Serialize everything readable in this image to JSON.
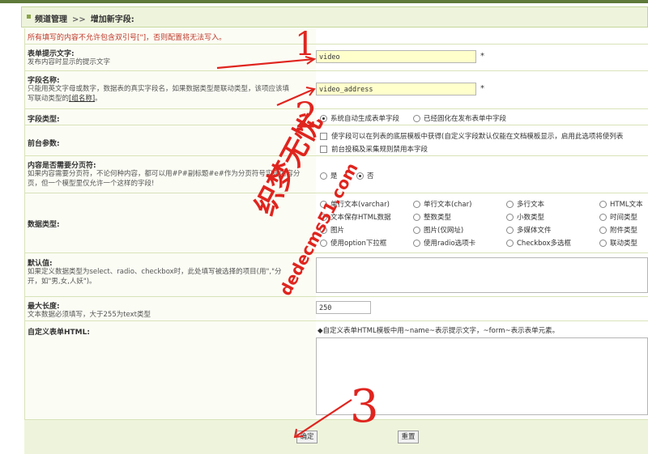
{
  "breadcrumb": {
    "parent": "频道管理",
    "separator": ">>",
    "current": "增加新字段:"
  },
  "warning": "所有填写的内容不允许包含双引号[\"]，否则配置将无法写入。",
  "fields": {
    "prompt_text": {
      "title": "表单提示文字:",
      "desc": "发布内容时显示的提示文字",
      "value": "video",
      "required": "*"
    },
    "field_name": {
      "title": "字段名称:",
      "desc": "只能用英文字母或数字，数据表的真实字段名，如果数据类型是联动类型，该项应该填",
      "desc2": "写联动类型的",
      "desc_link": "[组名称]",
      "desc3": "。",
      "value": "video_address",
      "required": "*"
    },
    "field_type": {
      "title": "字段类型:",
      "opt1": "系统自动生成表单字段",
      "opt2": "已经固化在发布表单中字段"
    },
    "frontend": {
      "title": "前台参数:",
      "opt1": "使字段可以在列表的底层模板中获得(自定义字段默认仅能在文档模板显示，启用此选项将使列表",
      "opt2": "前台投稿及采集规则禁用本字段"
    },
    "paging": {
      "title": "内容是否需要分页符:",
      "desc": "如果内容需要分页符，不论何种内容，都可以用#P#副标题#e#作为分页符号实现内容分",
      "desc2": "页，但一个模型里仅允许一个这样的字段!",
      "yes": "是",
      "no": "否"
    },
    "data_type": {
      "title": "数据类型:",
      "options": [
        [
          "单行文本(varchar)",
          "单行文本(char)",
          "多行文本",
          "HTML文本"
        ],
        [
          "文本保存HTML数据",
          "整数类型",
          "小数类型",
          "时间类型"
        ],
        [
          "图片",
          "图片(仅网址)",
          "多媒体文件",
          "附件类型"
        ],
        [
          "使用option下拉框",
          "使用radio选项卡",
          "Checkbox多选框",
          "联动类型"
        ]
      ]
    },
    "default_value": {
      "title": "默认值:",
      "desc": "如果定义数据类型为select、radio、checkbox时，此处填写被选择的项目(用\",\"分",
      "desc2": "开，如\"男,女,人妖\")。"
    },
    "max_length": {
      "title": "最大长度:",
      "desc": "文本数据必须填写，大于255为text类型",
      "value": "250"
    },
    "custom_html": {
      "title": "自定义表单HTML:",
      "hint": "◆自定义表单HTML模板中用~name~表示提示文字，~form~表示表单元素。"
    }
  },
  "buttons": {
    "ok": "确定",
    "reset": "重置"
  },
  "annotations": {
    "n1": "1",
    "n2": "2",
    "n3": "3"
  },
  "watermark": {
    "brand": "织梦无忧",
    "url": "dedecms51.com"
  },
  "colors": {
    "accent": "#5f7a3a",
    "input_bg": "#ffffcc",
    "warning": "#c0392b",
    "annotation": "#e0241e"
  }
}
